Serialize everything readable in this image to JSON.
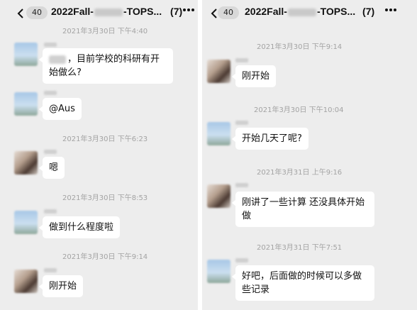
{
  "left": {
    "header": {
      "back_count": "40",
      "title_prefix": "2022Fall-",
      "title_suffix": "-TOPS...",
      "member_count": "(7)"
    },
    "messages": [
      {
        "time": "2021年3月30日 下午4:40",
        "text": "，目前学校的科研有开始做么?",
        "avatar": "sky"
      },
      {
        "time": "",
        "text": "@Aus",
        "avatar": "sky"
      },
      {
        "time": "2021年3月30日 下午6:23",
        "text": "嗯",
        "avatar": "dark"
      },
      {
        "time": "2021年3月30日 下午8:53",
        "text": "做到什么程度啦",
        "avatar": "sky"
      },
      {
        "time": "2021年3月30日 下午9:14",
        "text": "刚开始",
        "avatar": "dark"
      }
    ]
  },
  "right": {
    "header": {
      "back_count": "40",
      "title_prefix": "2022Fall-",
      "title_suffix": "-TOPS...",
      "member_count": "(7)"
    },
    "messages": [
      {
        "time": "2021年3月30日 下午9:14",
        "text": "刚开始",
        "avatar": "dark"
      },
      {
        "time": "2021年3月30日 下午10:04",
        "text": "开始几天了呢?",
        "avatar": "sky"
      },
      {
        "time": "2021年3月31日 上午9:16",
        "text": "刚讲了一些计算 还没具体开始做",
        "avatar": "dark"
      },
      {
        "time": "2021年3月31日 下午7:51",
        "text": "好吧，后面做的时候可以多做些记录",
        "avatar": "sky"
      }
    ]
  },
  "icons": {
    "back": "chevron-left-icon",
    "more": "more-dots-icon"
  }
}
